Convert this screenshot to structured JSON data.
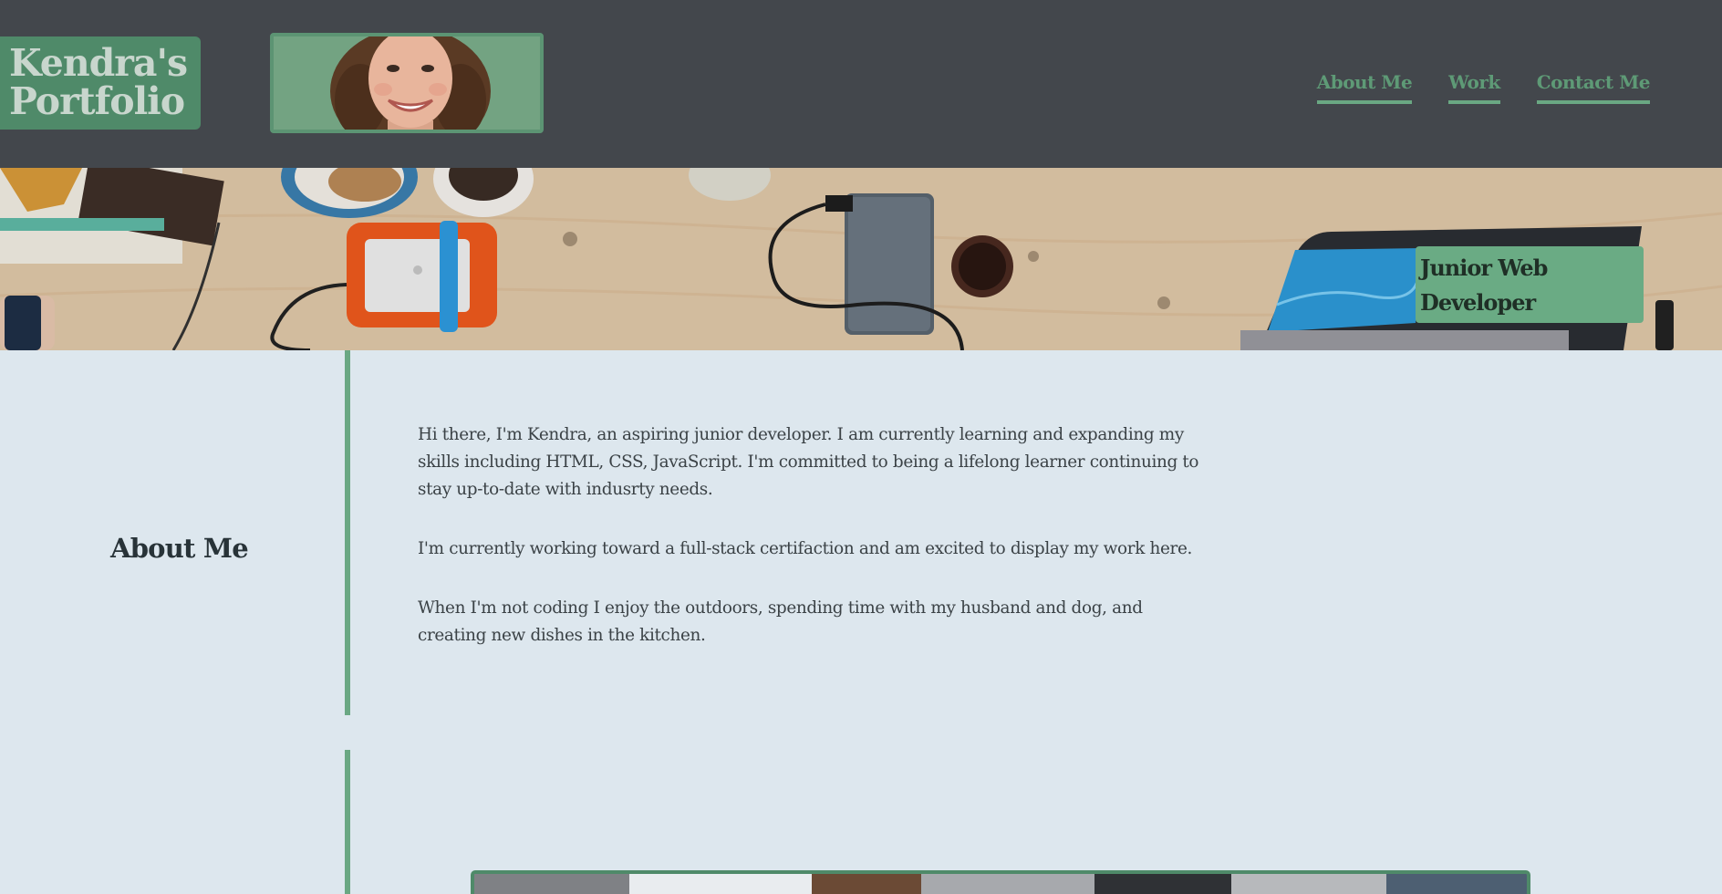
{
  "brand": {
    "line1": "Kendra's",
    "line2": "Portfolio"
  },
  "profile": {
    "alt": "Photo of Kendra"
  },
  "nav": {
    "items": [
      {
        "label": "About Me"
      },
      {
        "label": "Work"
      },
      {
        "label": "Contact Me"
      }
    ]
  },
  "hero": {
    "title_line1": "Junior Web",
    "title_line2": "Developer"
  },
  "about": {
    "heading": "About Me",
    "paragraphs": [
      "Hi there, I'm Kendra, an aspiring junior developer. I am currently learning and expanding my skills including HTML, CSS, JavaScript. I'm committed to being a lifelong learner continuing to stay up-to-date with indusrty needs.",
      "I'm currently working toward a full-stack certifaction and am excited to display my work here.",
      "When I'm not coding I enjoy the outdoors, spending time with my husband and dog, and creating new dishes in the kitchen."
    ]
  },
  "colors": {
    "header_bg": "#43474c",
    "accent_green": "#6aa883",
    "brand_bg": "#4f8a69",
    "page_bg": "#dde7ee",
    "body_text": "#3b4246"
  }
}
